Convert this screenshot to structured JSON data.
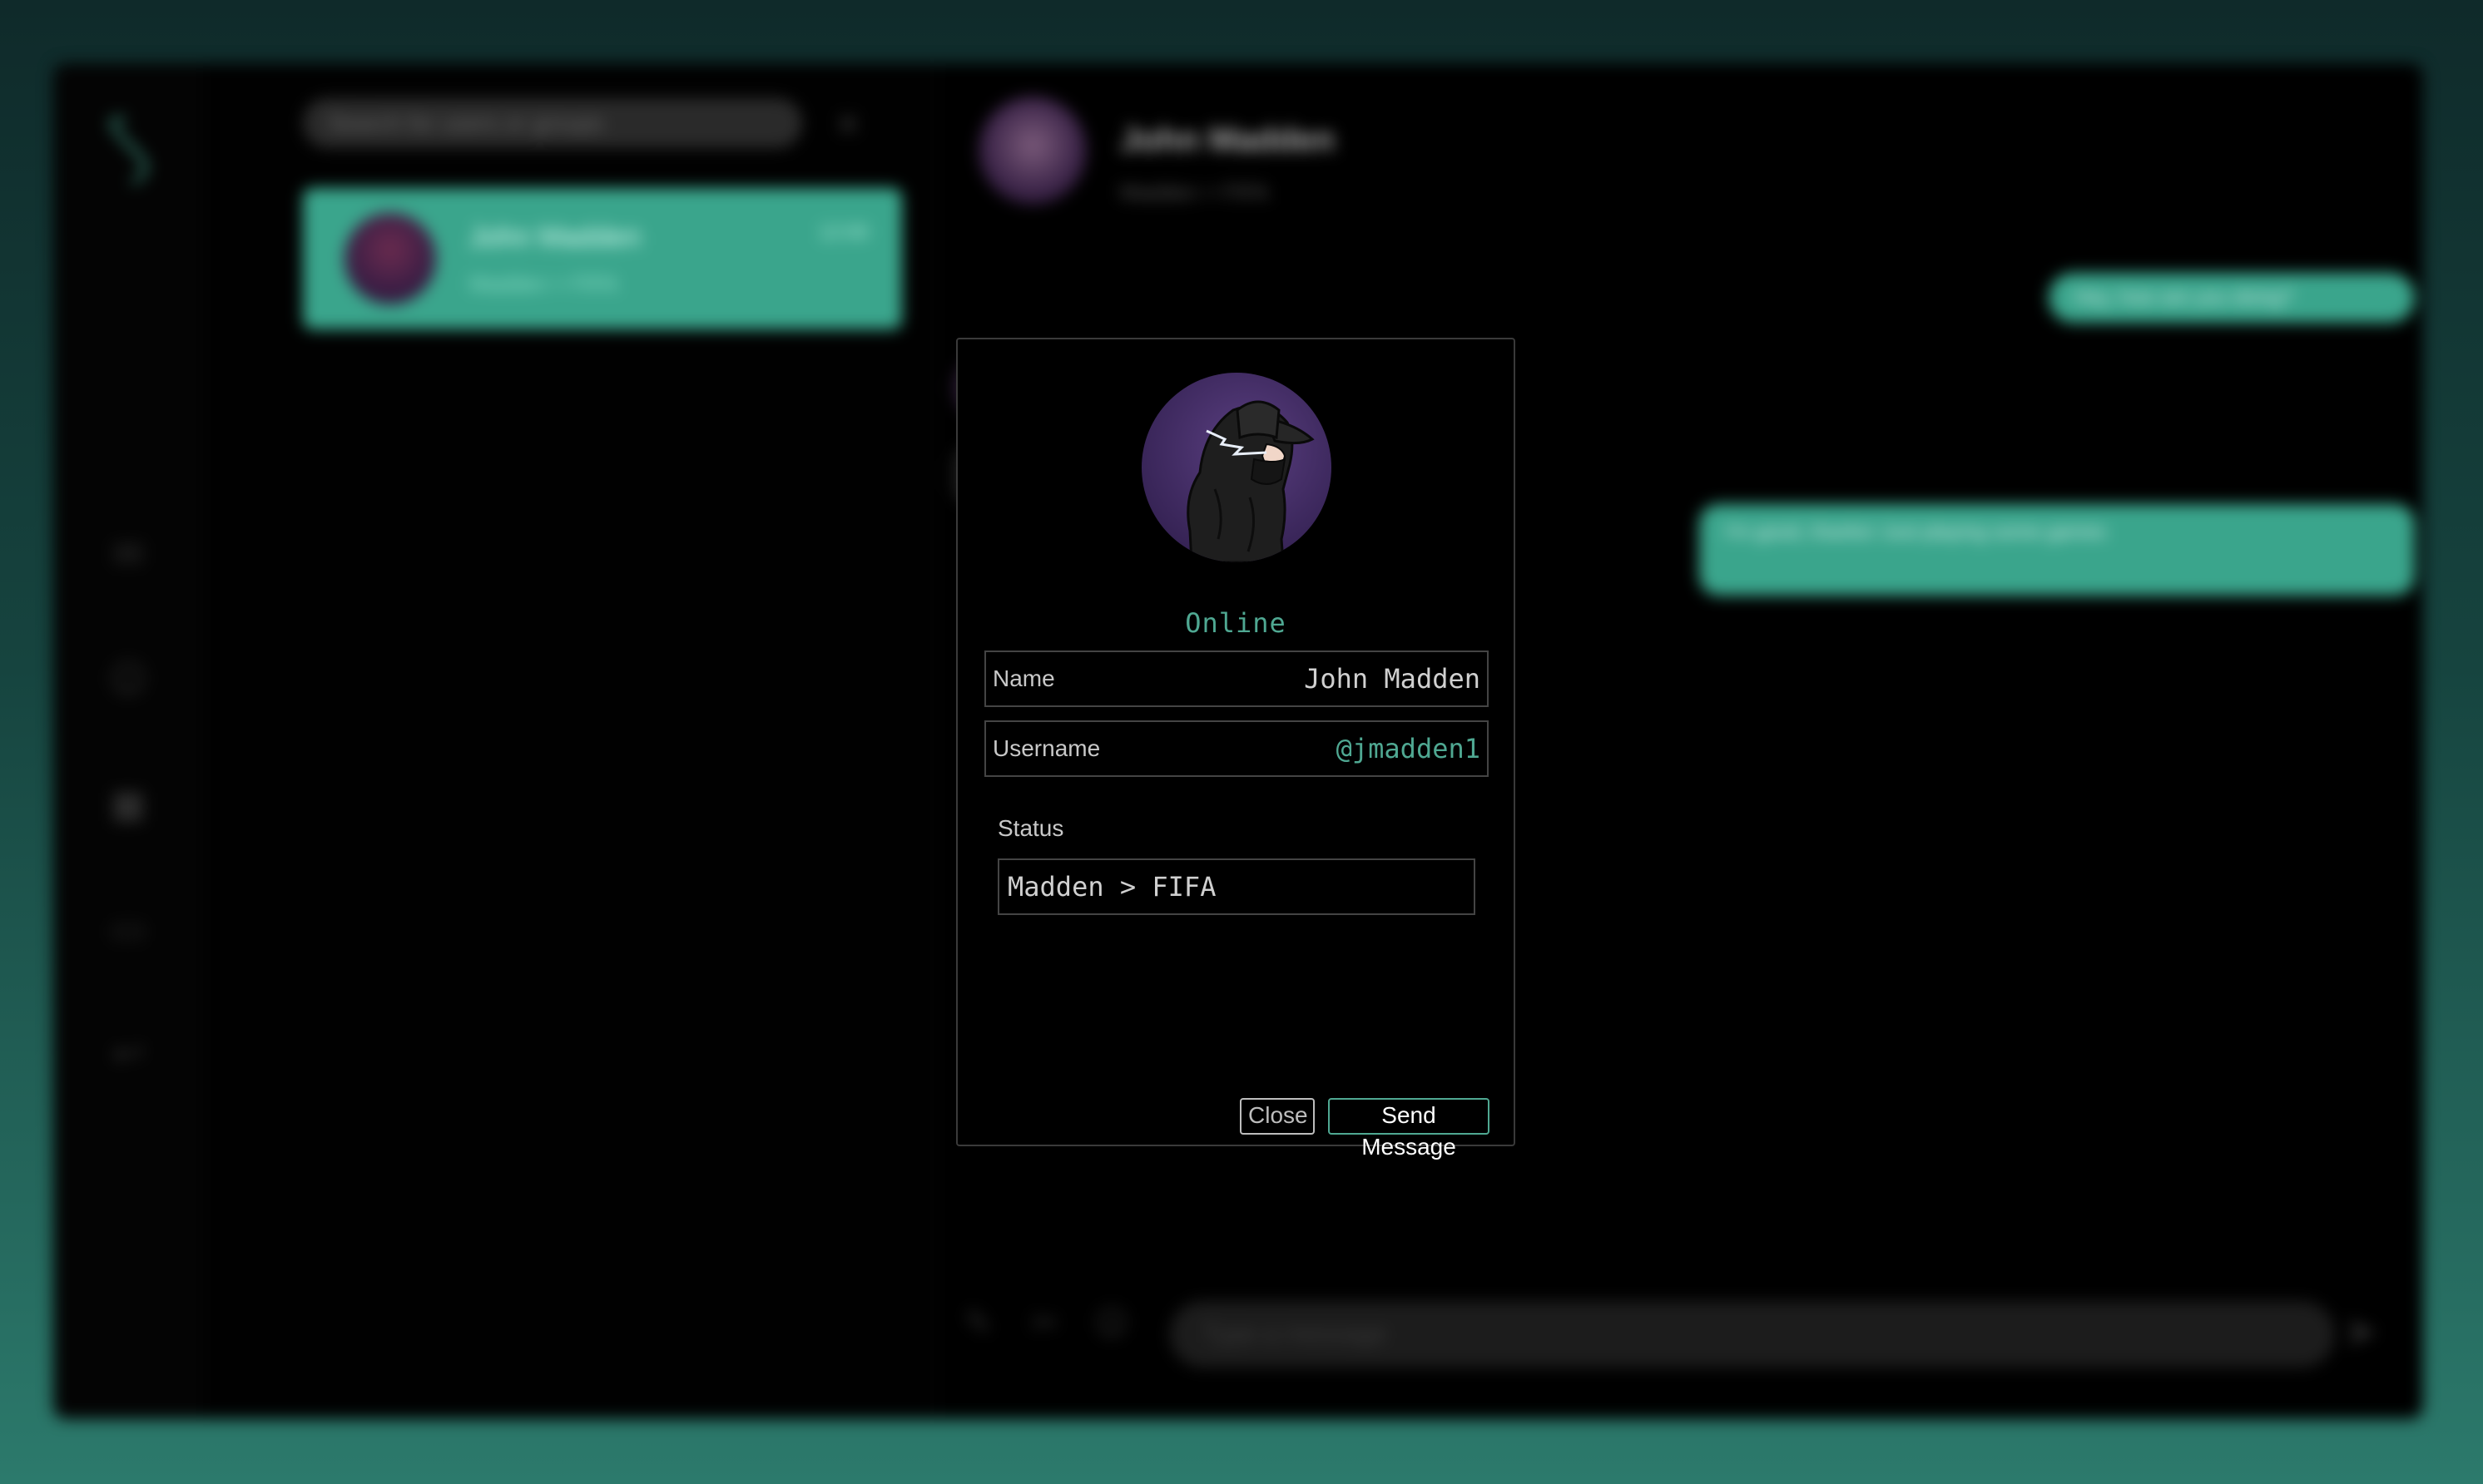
{
  "app": {
    "search": {
      "placeholder": "Search for users or groups"
    },
    "search_clear_icon": "close-icon",
    "nav": {
      "logo_icon": "logo-icon",
      "items": [
        {
          "icon": "chat-icon"
        },
        {
          "icon": "users-icon"
        },
        {
          "icon": "settings-icon"
        },
        {
          "icon": "folder-icon"
        },
        {
          "icon": "logout-icon"
        }
      ]
    },
    "chat_list": [
      {
        "name": "John Madden",
        "preview": "Madden > FIFA",
        "time": "12:00"
      }
    ],
    "chat_header": {
      "name": "John Madden",
      "sub": "Madden > FIFA"
    },
    "messages": [
      {
        "side": "right",
        "text": "Hey, how are you doing?"
      },
      {
        "side": "left",
        "text": "..."
      },
      {
        "side": "right",
        "text": "I'm good, thanks! Just playing some games"
      }
    ],
    "composer": {
      "placeholder": "Type a message",
      "icons": [
        "attach-icon",
        "image-icon",
        "emoji-icon"
      ],
      "send_icon": "send-icon"
    }
  },
  "profile_modal": {
    "avatar_icon": "user-avatar",
    "presence": "Online",
    "name_label": "Name",
    "name_value": "John Madden",
    "username_label": "Username",
    "username_value": "@jmadden1",
    "status_label": "Status",
    "status_value": "Madden > FIFA",
    "close_label": "Close",
    "send_label": "Send Message"
  },
  "colors": {
    "accent": "#4fa892",
    "accent_bg": "#3aa58c",
    "modal_bg": "#000000",
    "border": "#444444",
    "text": "#d0d0d0"
  }
}
